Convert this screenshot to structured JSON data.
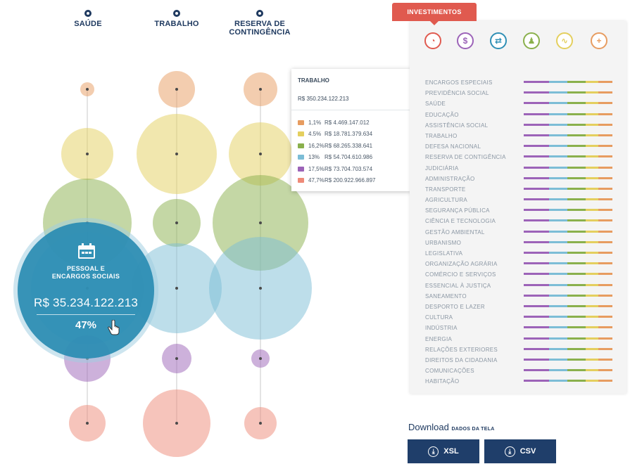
{
  "columns": [
    {
      "title": "SAÚDE",
      "title2": ""
    },
    {
      "title": "TRABALHO",
      "title2": ""
    },
    {
      "title": "RESERVA DE",
      "title2": "CONTINGÊNCIA"
    }
  ],
  "colors": {
    "red": "#ee8a78",
    "orange": "#e79c60",
    "purple": "#9c63b8",
    "blue": "#2f8fb5",
    "lightblue": "#7cbdd6",
    "green": "#8ab04c",
    "yellow": "#e4cf5e",
    "navy": "#1f3e6a"
  },
  "highlight": {
    "label_line1": "PESSOAL E",
    "label_line2": "ENCARGOS SOCIAIS",
    "value": "R$ 35.234.122.213",
    "percent": "47%"
  },
  "tooltip": {
    "title": "TRABALHO",
    "total": "R$ 350.234.122.213",
    "rows": [
      {
        "pct": "1,1%",
        "value": "R$ 4.469.147.012",
        "color": "#e79c60"
      },
      {
        "pct": "4.5%",
        "value": "R$ 18.781.379.634",
        "color": "#e4cf5e"
      },
      {
        "pct": "16,2%",
        "value": "R$ 68.265.338.641",
        "color": "#8ab04c"
      },
      {
        "pct": "13%",
        "value": "R$ 54.704.610.986",
        "color": "#7cbdd6"
      },
      {
        "pct": "17,5%",
        "value": "R$ 73.704.703.574",
        "color": "#9c63b8"
      },
      {
        "pct": "47,7%",
        "value": "R$ 200.922.966.897",
        "color": "#ee8a78"
      }
    ]
  },
  "panel": {
    "tab_label": "INVESTIMENTOS",
    "category_icons": [
      {
        "name": "piggy-icon",
        "glyph": "◔",
        "color": "#e05a4f"
      },
      {
        "name": "dollar-icon",
        "glyph": "$",
        "color": "#9c63b8"
      },
      {
        "name": "shuffle-icon",
        "glyph": "⇄",
        "color": "#2f8fb5"
      },
      {
        "name": "person-icon",
        "glyph": "♟",
        "color": "#8ab04c"
      },
      {
        "name": "chart-icon",
        "glyph": "∿",
        "color": "#e4cf5e"
      },
      {
        "name": "plus-icon",
        "glyph": "+",
        "color": "#e79c60"
      }
    ],
    "items": [
      "ENCARGOS ESPECIAIS",
      "PREVIDÊNCIA SOCIAL",
      "SAÚDE",
      "EDUCAÇÃO",
      "ASSISTÊNCIA SOCIAL",
      "TRABALHO",
      "DEFESA NACIONAL",
      "RESERVA DE CONTIGÊNCIA",
      "JUDICIÁRIA",
      "ADMINISTRAÇÃO",
      "TRANSPORTE",
      "AGRICULTURA",
      "SEGURANÇA PÚBLICA",
      "CIÊNCIA E TECNOLOGIA",
      "GESTÃO AMBIENTAL",
      "URBANISMO",
      "LEGISLATIVA",
      "ORGANIZAÇÃO AGRÁRIA",
      "COMÉRCIO E SERVIÇOS",
      "ESSENCIAL À JUSTIÇA",
      "SANEAMENTO",
      "DESPORTO E LAZER",
      "CULTURA",
      "INDÚSTRIA",
      "ENERGIA",
      "RELAÇÕES EXTERIORES",
      "DIREITOS DA CIDADANIA",
      "COMUNICAÇÕES",
      "HABITAÇÃO"
    ]
  },
  "download": {
    "title": "Download",
    "subtitle": "DADOS DA TELA",
    "buttons": [
      {
        "label": "XSL",
        "icon": "download-icon"
      },
      {
        "label": "CSV",
        "icon": "download-icon"
      }
    ]
  }
}
